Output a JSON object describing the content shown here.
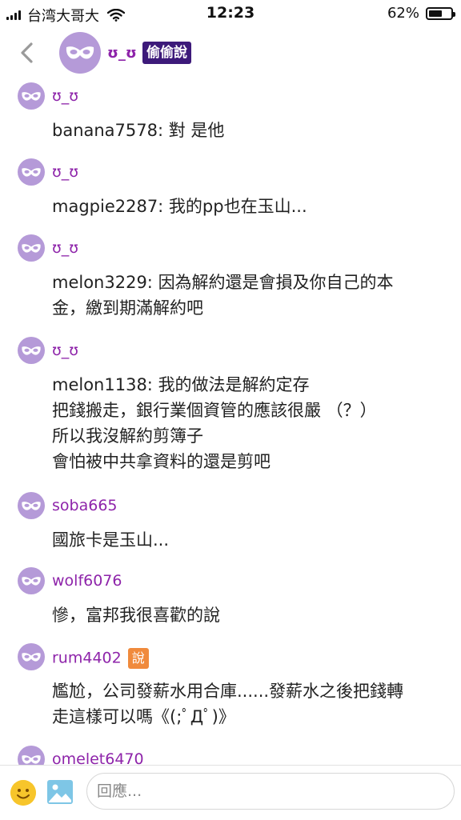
{
  "status_bar": {
    "carrier": "台湾大哥大",
    "time": "12:23",
    "battery": "62%",
    "battery_level": 0.62
  },
  "header": {
    "name": "ʊ_ʊ",
    "badge": "偷偷說"
  },
  "messages": [
    {
      "name": "ʊ_ʊ",
      "badge": "",
      "text": "banana7578: 對 是他"
    },
    {
      "name": "ʊ_ʊ",
      "badge": "",
      "text": "magpie2287: 我的pp也在玉山..."
    },
    {
      "name": "ʊ_ʊ",
      "badge": "",
      "text": "melon3229: 因為解約還是會損及你自己的本\n金，繳到期滿解約吧"
    },
    {
      "name": "ʊ_ʊ",
      "badge": "",
      "text": "melon1138: 我的做法是解約定存\n把錢搬走，銀行業個資管的應該很嚴 （？）\n所以我沒解約剪簿子\n會怕被中共拿資料的還是剪吧"
    },
    {
      "name": "soba665",
      "badge": "",
      "text": "國旅卡是玉山..."
    },
    {
      "name": "wolf6076",
      "badge": "",
      "text": "慘，富邦我很喜歡的說"
    },
    {
      "name": "rum4402",
      "badge": "說",
      "text": "尷尬，公司發薪水用合庫......發薪水之後把錢轉\n走這樣可以嗎《(;ﾟДﾟ)》"
    },
    {
      "name": "omelet6470",
      "badge": "",
      "text": ""
    }
  ],
  "composer": {
    "placeholder": "回應..."
  },
  "colors": {
    "accent_purple": "#8e24aa",
    "avatar_lavender": "#b59ad8",
    "badge_dark_purple": "#3d1a7a",
    "badge_orange": "#f08a3c"
  },
  "icons": {
    "back": "chevron-left-icon",
    "avatar": "mask-icon",
    "emoji": "smiley-icon",
    "image": "image-icon",
    "wifi": "wifi-icon",
    "signal": "signal-icon",
    "battery": "battery-icon"
  }
}
